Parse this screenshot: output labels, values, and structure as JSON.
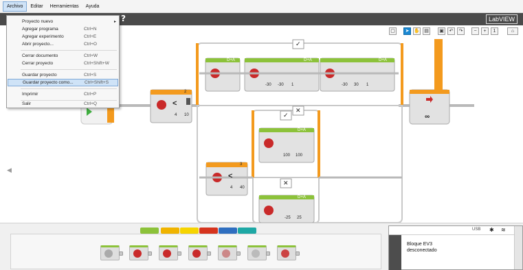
{
  "menubar": {
    "items": [
      "Archivo",
      "Editar",
      "Herramientas",
      "Ayuda"
    ]
  },
  "titlebar": {
    "help": "?",
    "product": "LabVIEW"
  },
  "file_menu": {
    "items": [
      {
        "label": "Proyecto nuevo",
        "shortcut": "",
        "submenu": true
      },
      {
        "label": "Agregar programa",
        "shortcut": "Ctrl+N"
      },
      {
        "label": "Agregar experimento",
        "shortcut": "Ctrl+E"
      },
      {
        "label": "Abrir proyecto...",
        "shortcut": "Ctrl+O"
      },
      {
        "label": "Cerrar documento",
        "shortcut": "Ctrl+W"
      },
      {
        "label": "Cerrar proyecto",
        "shortcut": "Ctrl+Shift+W"
      },
      {
        "label": "Guardar proyecto",
        "shortcut": "Ctrl+S"
      },
      {
        "label": "Guardar proyecto como...",
        "shortcut": "Ctrl+Shift+S"
      },
      {
        "label": "Imprimir",
        "shortcut": "Ctrl+P"
      },
      {
        "label": "Salir",
        "shortcut": "Ctrl+Q"
      }
    ],
    "highlighted_index": 7
  },
  "blocks": {
    "port_da": "D+A",
    "switch_top_port": "2",
    "switch_top_values": [
      "4",
      "10"
    ],
    "switch_mid_port": "3",
    "switch_mid_values": [
      "4",
      "40"
    ],
    "move_1_values": [
      "-30",
      "-30",
      "1"
    ],
    "move_2_values": [
      "-30",
      "30",
      "1"
    ],
    "move_mid_values": [
      "100",
      "100"
    ],
    "move_bottom_values": [
      "-25",
      "25"
    ],
    "check": "✓",
    "cross": "✕",
    "loop_symbol": "∞",
    "lt": "<"
  },
  "status": {
    "ev3_line1": "Bloque EV3",
    "ev3_line2": "desconectado",
    "usb": "USB"
  },
  "palette": {
    "tab_colors": [
      "#8cc23a",
      "#f0b400",
      "#f6d400",
      "#d6341e",
      "#2f6fc0",
      "#1ea8a5"
    ]
  },
  "colors": {
    "accent_orange": "#f39a1e",
    "block_gray": "#d9d9d9",
    "green": "#8cc23a",
    "title_dark": "#4a4a4a"
  }
}
